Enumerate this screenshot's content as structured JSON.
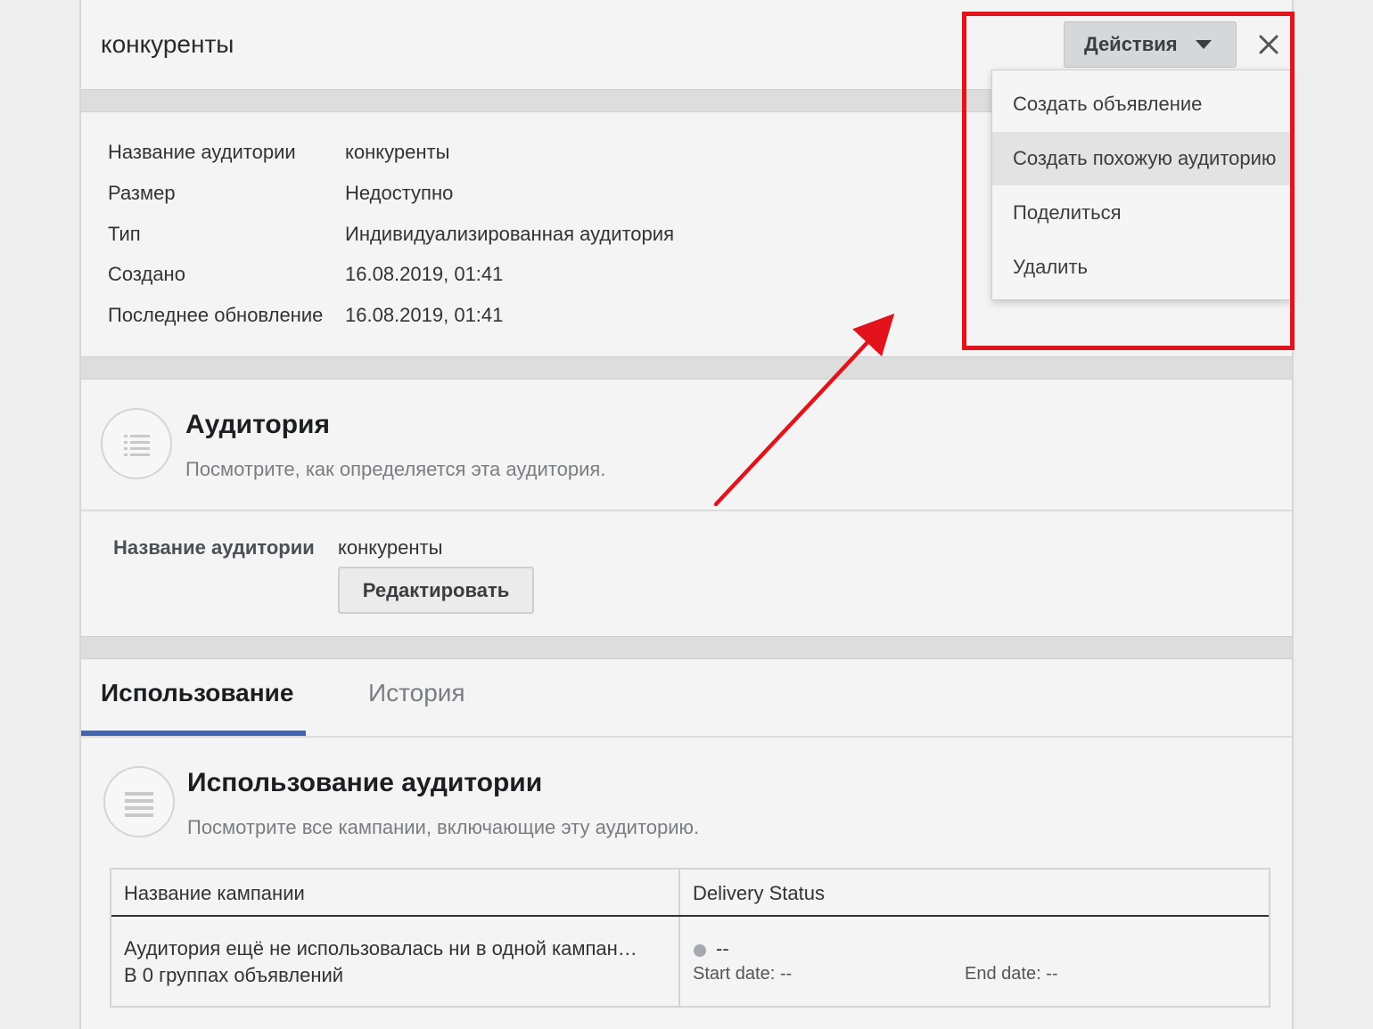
{
  "panel": {
    "title": "конкуренты"
  },
  "toolbar": {
    "actions_label": "Действия"
  },
  "actions_menu": {
    "items": [
      {
        "label": "Создать объявление"
      },
      {
        "label": "Создать похожую аудиторию"
      },
      {
        "label": "Поделиться"
      },
      {
        "label": "Удалить"
      }
    ],
    "highlighted_index": 1
  },
  "details": {
    "rows": [
      {
        "label": "Название аудитории",
        "value": "конкуренты"
      },
      {
        "label": "Размер",
        "value": "Недоступно"
      },
      {
        "label": "Тип",
        "value": "Индивидуализированная аудитория"
      },
      {
        "label": "Создано",
        "value": "16.08.2019, 01:41"
      },
      {
        "label": "Последнее обновление",
        "value": "16.08.2019, 01:41"
      }
    ]
  },
  "audience_section": {
    "title": "Аудитория",
    "subtitle": "Посмотрите, как определяется эта аудитория.",
    "name_label": "Название аудитории",
    "name_value": "конкуренты",
    "edit_label": "Редактировать"
  },
  "tabs": [
    {
      "label": "Использование",
      "active": true
    },
    {
      "label": "История",
      "active": false
    }
  ],
  "usage_section": {
    "title": "Использование аудитории",
    "subtitle": "Посмотрите все кампании, включающие эту аудиторию."
  },
  "usage_table": {
    "headers": [
      "Название кампании",
      "Delivery Status"
    ],
    "row": {
      "campaign_line1": "Аудитория ещё не использовалась ни в одной кампан…",
      "campaign_line2": "В 0 группах объявлений",
      "status": "--",
      "start_date": "Start date: --",
      "end_date": "End date: --"
    }
  },
  "colors": {
    "annotation_red": "#e3131b",
    "tab_accent": "#4267b2",
    "status_dot": "#a5a8ad"
  }
}
